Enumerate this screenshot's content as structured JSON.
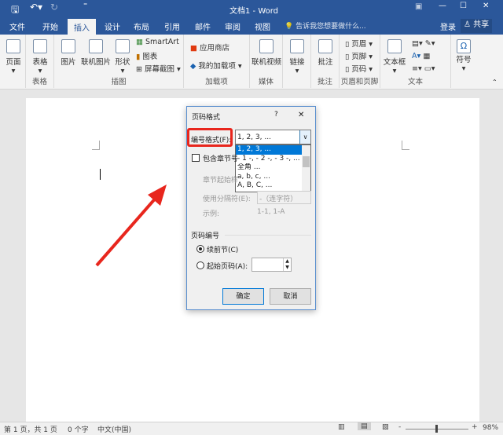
{
  "window": {
    "title": "文档1 - Word",
    "accent": "#2b579a"
  },
  "tabs": [
    "文件",
    "开始",
    "插入",
    "设计",
    "布局",
    "引用",
    "邮件",
    "审阅",
    "视图"
  ],
  "active_tab": "插入",
  "tell_me": "告诉我您想要做什么...",
  "login": "登录",
  "share": "共享",
  "ribbon": {
    "pages": "页面",
    "table": "表格",
    "table_group": "表格",
    "picture": "图片",
    "online_picture": "联机图片",
    "shapes": "形状",
    "smartart": "SmartArt",
    "chart": "图表",
    "screenshot": "屏幕截图",
    "illustrations_group": "插图",
    "store": "应用商店",
    "my_addins": "我的加载项",
    "addins_group": "加载项",
    "online_video": "联机视频",
    "media_group": "媒体",
    "link": "链接",
    "comment": "批注",
    "comments_group": "批注",
    "header": "页眉",
    "footer": "页脚",
    "page_number": "页码",
    "hf_group": "页眉和页脚",
    "textbox": "文本框",
    "text_group": "文本",
    "symbol": "符号"
  },
  "dialog": {
    "title": "页码格式",
    "help": "?",
    "close": "✕",
    "format_label": "编号格式(F):",
    "format_value": "1, 2, 3, ...",
    "format_options": [
      "1, 2, 3, ...",
      "- 1 -, - 2 -, - 3 -, ...",
      "全角 ...",
      "a, b, c, ...",
      "A, B, C, ..."
    ],
    "include_chapter": "包含章节号",
    "chapter_style": "章节起始样",
    "separator_label": "使用分隔符(E):",
    "separator_value": "-（连字符）",
    "example_label": "示例:",
    "example_value": "1-1, 1-A",
    "numbering_group": "页码编号",
    "continue": "续前节(C)",
    "start_at": "起始页码(A):",
    "ok": "确定",
    "cancel": "取消"
  },
  "status": {
    "page": "第 1 页，共 1 页",
    "words": "0 个字",
    "lang": "中文(中国)",
    "zoom": "98%"
  }
}
